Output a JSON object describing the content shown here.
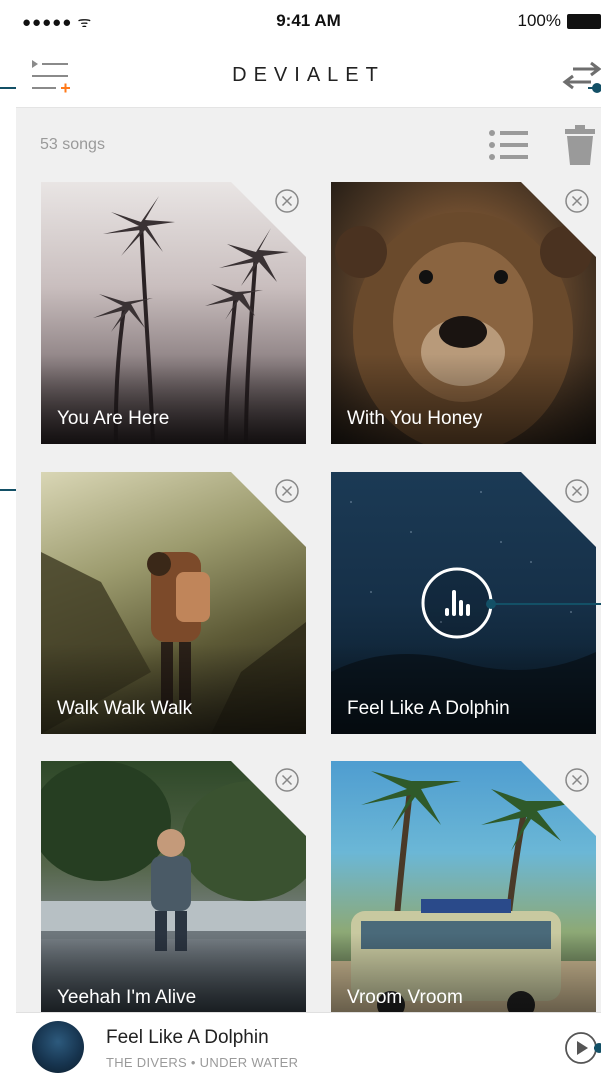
{
  "status_bar": {
    "signal": "●●●●● ᯤ",
    "time": "9:41 AM",
    "battery": "100%"
  },
  "nav": {
    "title": "DEVIALET"
  },
  "toolbar": {
    "song_count": "53 songs"
  },
  "songs": [
    {
      "title": "You Are Here"
    },
    {
      "title": "With You Honey"
    },
    {
      "title": "Walk Walk Walk"
    },
    {
      "title": "Feel Like A Dolphin",
      "playing": true
    },
    {
      "title": "Yeehah I'm Alive"
    },
    {
      "title": "Vroom Vroom"
    }
  ],
  "now_playing": {
    "title": "Feel Like A Dolphin",
    "subtitle": "THE DIVERS • UNDER WATER"
  },
  "colors": {
    "accent": "#ff7a1a",
    "callout": "#135066",
    "background": "#f0f0f0"
  },
  "icons": [
    "add-to-queue-icon",
    "shuffle-repeat-icon",
    "list-view-icon",
    "trash-icon",
    "close-circle-icon",
    "equalizer-play-icon",
    "play-circle-icon"
  ]
}
